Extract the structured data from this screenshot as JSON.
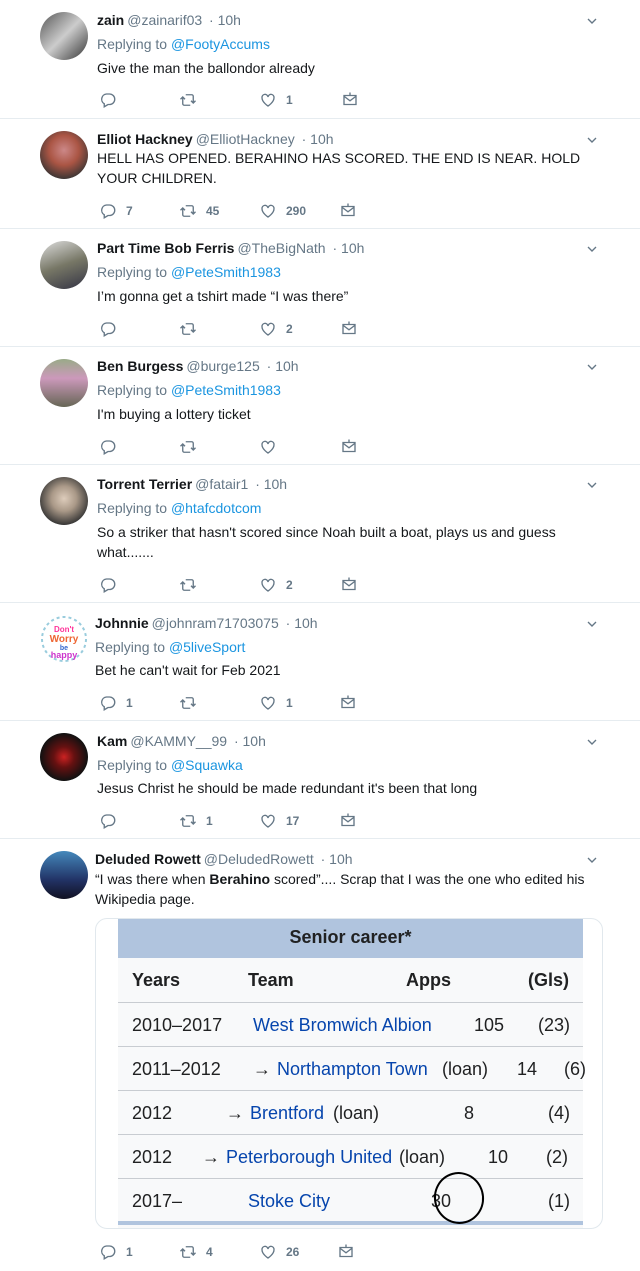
{
  "colors": {
    "link": "#1b95e0",
    "muted": "#657786",
    "text": "#14171a",
    "divider": "#e6ecf0"
  },
  "icons": {
    "reply": "reply-icon",
    "retweet": "retweet-icon",
    "like": "heart-icon",
    "dm": "envelope-icon",
    "caret": "chevron-down-icon"
  },
  "tweets": [
    {
      "name": "zain",
      "handle": "@zainarif03",
      "time": "· 10h",
      "replying_label": "Replying to",
      "replying_to": "@FootyAccums",
      "text": "Give the man the ballondor already",
      "replies": "",
      "retweets": "",
      "likes": "1"
    },
    {
      "name": "Elliot Hackney",
      "handle": "@ElliotHackney",
      "time": "· 10h",
      "text": "HELL HAS OPENED. BERAHINO HAS SCORED. THE END IS NEAR. HOLD YOUR CHILDREN.",
      "replies": "7",
      "retweets": "45",
      "likes": "290"
    },
    {
      "name": "Part Time Bob Ferris",
      "handle": "@TheBigNath",
      "time": "· 10h",
      "replying_label": "Replying to",
      "replying_to": "@PeteSmith1983",
      "text": "I’m gonna get a tshirt made “I was there”",
      "replies": "",
      "retweets": "",
      "likes": "2"
    },
    {
      "name": "Ben Burgess",
      "handle": "@burge125",
      "time": "· 10h",
      "replying_label": "Replying to",
      "replying_to": "@PeteSmith1983",
      "text": "I'm buying a lottery ticket",
      "replies": "",
      "retweets": "",
      "likes": ""
    },
    {
      "name": "Torrent Terrier",
      "handle": "@fatair1",
      "time": "· 10h",
      "replying_label": "Replying to",
      "replying_to": "@htafcdotcom",
      "text": "So a striker that hasn't scored since Noah built a boat, plays us and guess what.......",
      "replies": "",
      "retweets": "",
      "likes": "2"
    },
    {
      "name": "Johnnie",
      "handle": "@johnram71703075",
      "time": "· 10h",
      "replying_label": "Replying to",
      "replying_to": "@5liveSport",
      "text": "Bet he can't wait for Feb 2021",
      "replies": "1",
      "retweets": "",
      "likes": "1",
      "avatar_text": "Don't Worry be Happy"
    },
    {
      "name": "Kam",
      "handle": "@KAMMY__99",
      "time": "· 10h",
      "replying_label": "Replying to",
      "replying_to": "@Squawka",
      "text": "Jesus Christ he should be made redundant it's been that long",
      "replies": "",
      "retweets": "1",
      "likes": "17"
    },
    {
      "name": "Deluded Rowett",
      "handle": "@DeludedRowett",
      "time": "· 10h",
      "text_a": "“I was there when ",
      "text_b": "Berahino",
      "text_c": " scored”.... Scrap that I was the one who edited his Wikipedia page.",
      "replies": "1",
      "retweets": "4",
      "likes": "26"
    }
  ],
  "wiki": {
    "title": "Senior career*",
    "headers": {
      "years": "Years",
      "team": "Team",
      "apps": "Apps",
      "gls": "(Gls)"
    },
    "rows": [
      {
        "years": "2010–2017",
        "arrow": "",
        "team": "West Bromwich Albion",
        "loan": "",
        "apps": "105",
        "gls": "(23)"
      },
      {
        "years": "2011–2012",
        "arrow": "→",
        "team": "Northampton Town",
        "loan": "(loan)",
        "apps": "14",
        "gls": "(6)"
      },
      {
        "years": "2012",
        "arrow": "→",
        "team": "Brentford",
        "loan": "(loan)",
        "apps": "8",
        "gls": "(4)"
      },
      {
        "years": "2012",
        "arrow": "→",
        "team": "Peterborough United",
        "loan": "(loan)",
        "apps": "10",
        "gls": "(2)"
      },
      {
        "years": "2017–",
        "arrow": "",
        "team": "Stoke City",
        "loan": "",
        "apps": "30",
        "gls": "(1)"
      }
    ]
  }
}
